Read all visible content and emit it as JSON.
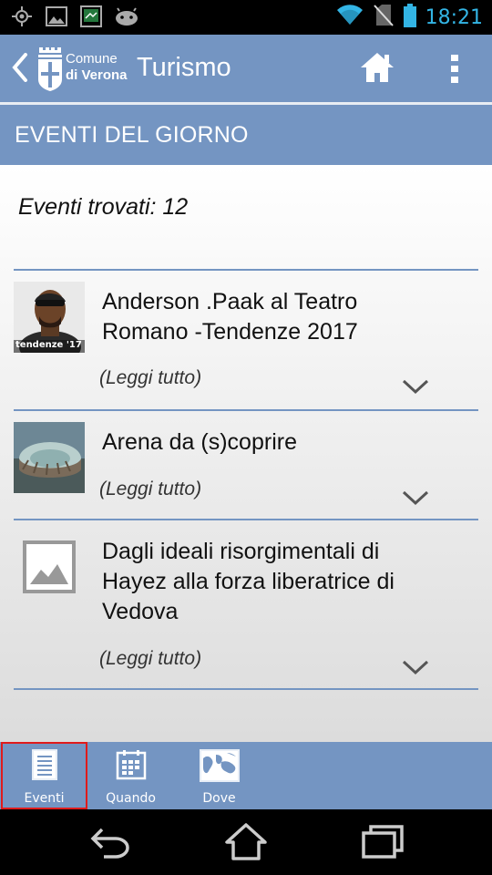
{
  "status_bar": {
    "time": "18:21",
    "icons": [
      "gps-icon",
      "gallery-icon",
      "screen-icon",
      "android-icon",
      "wifi-icon",
      "no-sim-icon",
      "battery-icon"
    ]
  },
  "action_bar": {
    "logo_line1": "Comune",
    "logo_line2": "di Verona",
    "title": "Turismo",
    "icons": [
      "back-chevron-icon",
      "home-icon",
      "overflow-menu-icon"
    ]
  },
  "section": {
    "title": "EVENTI DEL GIORNO"
  },
  "results": {
    "label": "Eventi trovati: 12"
  },
  "events": [
    {
      "title_line1": "Anderson .Paak al Teatro",
      "title_line2": "Romano -Tendenze 2017",
      "thumb_caption": "tendenze '17",
      "read_more": "(Leggi tutto)"
    },
    {
      "title_line1": "Arena da (s)coprire",
      "read_more": "(Leggi tutto)"
    },
    {
      "title_line1": "Dagli ideali risorgimentali di",
      "title_line2": "Hayez alla forza liberatrice di",
      "title_line3": "Vedova",
      "read_more": "(Leggi tutto)"
    }
  ],
  "tabs": [
    {
      "label": "Eventi",
      "icon": "list-icon",
      "active": true
    },
    {
      "label": "Quando",
      "icon": "calendar-icon",
      "active": false
    },
    {
      "label": "Dove",
      "icon": "map-icon",
      "active": false
    }
  ],
  "colors": {
    "primary": "#7495c2",
    "active_outline": "#e01b1b",
    "status_accent": "#33b5e5"
  }
}
